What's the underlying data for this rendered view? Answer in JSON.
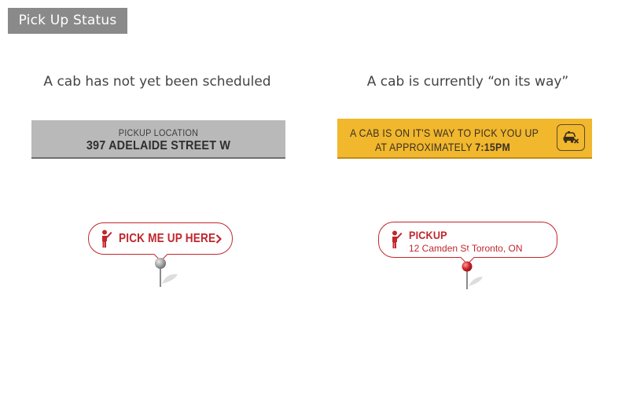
{
  "header": {
    "title": "Pick Up Status"
  },
  "scenarios": {
    "not_scheduled": {
      "caption": "A cab has not yet been scheduled",
      "bar": {
        "label": "PICKUP LOCATION",
        "address": "397 ADELAIDE STREET W",
        "color": "#b9b9b9"
      },
      "bubble": {
        "button_label": "PICK ME UP HERE",
        "icons": [
          "person-hailing-icon",
          "chevron-right-icon"
        ],
        "pin_color": "#a0a0a0"
      }
    },
    "on_its_way": {
      "caption": "A cab is currently “on its way”",
      "bar": {
        "line1": "A CAB IS ON IT'S WAY TO PICK YOU UP",
        "line2_prefix": "AT APPROXIMATELY ",
        "eta": "7:15PM",
        "color": "#f1b72d",
        "cancel_icon": "cab-cancel-icon"
      },
      "bubble": {
        "title": "PICKUP",
        "address": "12 Camden St Toronto, ON",
        "icons": [
          "person-hailing-icon"
        ],
        "pin_color": "#d0262d"
      }
    }
  },
  "colors": {
    "accent_red": "#c0272d",
    "badge_grey": "#8a8a8a"
  }
}
